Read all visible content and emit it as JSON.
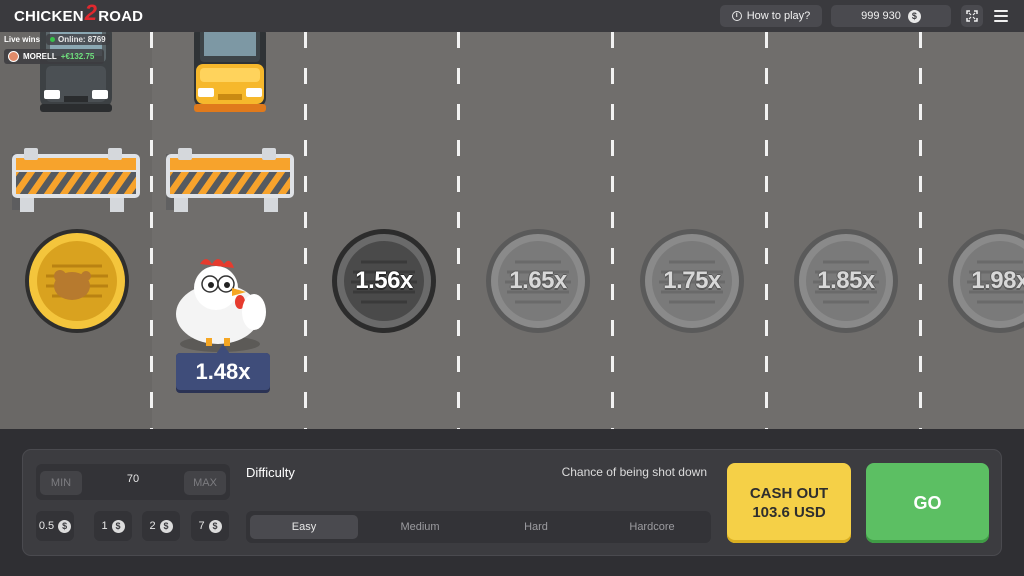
{
  "app": {
    "logo_left": "CHICKEN",
    "logo_mid": "2",
    "logo_right": "ROAD"
  },
  "header": {
    "how_to_play": "How to play?",
    "balance": "999 930",
    "currency_icon": "$"
  },
  "live": {
    "label": "Live wins",
    "online": "Online: 8769",
    "user": "MORELL",
    "amount": "+€132.75"
  },
  "lanes": {
    "current_multiplier": "1.48x",
    "multipliers": [
      "1.56x",
      "1.65x",
      "1.75x",
      "1.85x",
      "1.98x"
    ]
  },
  "bet": {
    "min_label": "MIN",
    "max_label": "MAX",
    "value": "70",
    "chips": [
      "0.5",
      "1",
      "2",
      "7"
    ]
  },
  "difficulty": {
    "title": "Difficulty",
    "chance_label": "Chance of being shot down",
    "options": [
      "Easy",
      "Medium",
      "Hard",
      "Hardcore"
    ],
    "selected": "Easy"
  },
  "actions": {
    "cashout_line1": "CASH OUT",
    "cashout_line2": "103.6 USD",
    "go": "GO"
  },
  "colors": {
    "road": "#706e6c",
    "cashout": "#f5d047",
    "go": "#5cbf63",
    "badge": "#3f4d7a",
    "gold_coin": "#e9b62a"
  }
}
